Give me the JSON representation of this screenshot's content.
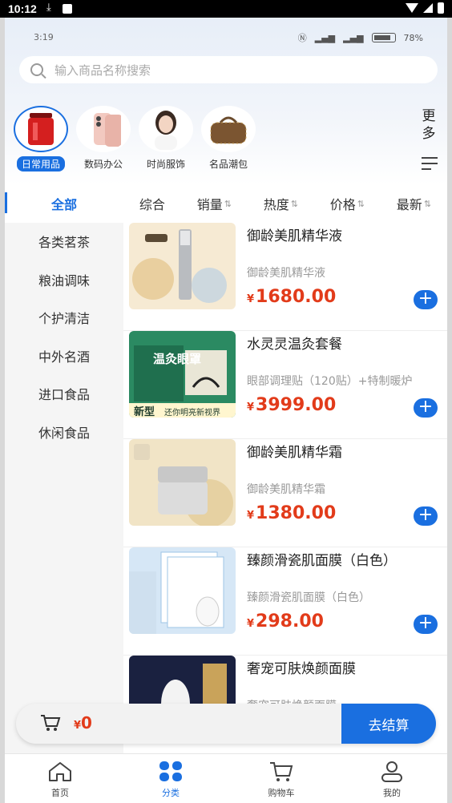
{
  "system_status": {
    "time": "10:12"
  },
  "inner_status": {
    "time": "3:19",
    "battery": "78%"
  },
  "search": {
    "placeholder": "输入商品名称搜索"
  },
  "categories": [
    {
      "label": "日常用品",
      "active": true
    },
    {
      "label": "数码办公",
      "active": false
    },
    {
      "label": "时尚服饰",
      "active": false
    },
    {
      "label": "名品潮包",
      "active": false
    }
  ],
  "more": {
    "label": "更多"
  },
  "sidebar": {
    "items": [
      "全部",
      "各类茗茶",
      "粮油调味",
      "个护清洁",
      "中外名酒",
      "进口食品",
      "休闲食品"
    ]
  },
  "sort": {
    "items": [
      {
        "label": "综合",
        "arrow": ""
      },
      {
        "label": "销量",
        "arrow": "⇅"
      },
      {
        "label": "热度",
        "arrow": "⇅"
      },
      {
        "label": "价格",
        "arrow": "⇅"
      },
      {
        "label": "最新",
        "arrow": "⇅"
      }
    ]
  },
  "products": [
    {
      "name": "御龄美肌精华液",
      "subtitle": "御龄美肌精华液",
      "currency": "¥",
      "price": "1680.00",
      "image_label": "",
      "colors": [
        "#f4e6cf",
        "#cfd6dc"
      ]
    },
    {
      "name": "水灵灵温灸套餐",
      "subtitle": "眼部调理贴（120贴）+特制暖炉",
      "currency": "¥",
      "price": "3999.00",
      "image_label": "温灸眼罩",
      "image_tag": "新型",
      "image_tag2": "还你明亮新视界",
      "colors": [
        "#2c8b63",
        "#ead58e"
      ]
    },
    {
      "name": "御龄美肌精华霜",
      "subtitle": "御龄美肌精华霜",
      "currency": "¥",
      "price": "1380.00",
      "image_label": "",
      "colors": [
        "#efe1c4",
        "#d8d8d8"
      ]
    },
    {
      "name": "臻颜滑瓷肌面膜（白色）",
      "subtitle": "臻颜滑瓷肌面膜（白色）",
      "currency": "¥",
      "price": "298.00",
      "image_label": "",
      "colors": [
        "#dbe9f6",
        "#ffffff"
      ]
    },
    {
      "name": "奢宠可肤焕颜面膜",
      "subtitle": "奢宠可肤焕颜面膜",
      "currency": "¥",
      "price": "",
      "image_label": "",
      "colors": [
        "#1b2444",
        "#c9a35a"
      ]
    }
  ],
  "cart": {
    "currency": "¥",
    "total": "0",
    "checkout_label": "去结算"
  },
  "tabbar": {
    "items": [
      {
        "label": "首页",
        "icon": "home-icon",
        "active": false
      },
      {
        "label": "分类",
        "icon": "category-icon",
        "active": true
      },
      {
        "label": "购物车",
        "icon": "cart-icon",
        "active": false
      },
      {
        "label": "我的",
        "icon": "user-icon",
        "active": false
      }
    ]
  },
  "theme": {
    "accent": "#1a6fe0",
    "price": "#e23b1a"
  }
}
